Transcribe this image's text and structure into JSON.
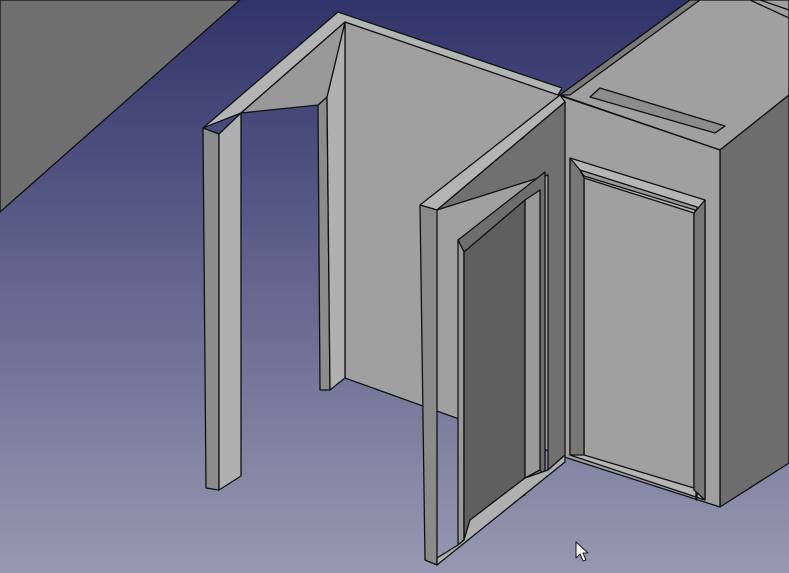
{
  "view": {
    "background_top_color": "#33336b",
    "background_bottom_color": "#9898b2",
    "shaded_face_color": "#a0a0a0",
    "face_dark_color": "#6b6b6b",
    "face_mid_color": "#8a8a8a",
    "face_light_color": "#b6b6b6",
    "edge_color": "#111111"
  },
  "scene": {
    "objects": [
      "wall-with-opening",
      "corner-wall",
      "door-left",
      "door-right",
      "adjacent-wall-block",
      "background-wall-block"
    ]
  },
  "cursor": {
    "icon": "mouse-pointer-icon"
  }
}
